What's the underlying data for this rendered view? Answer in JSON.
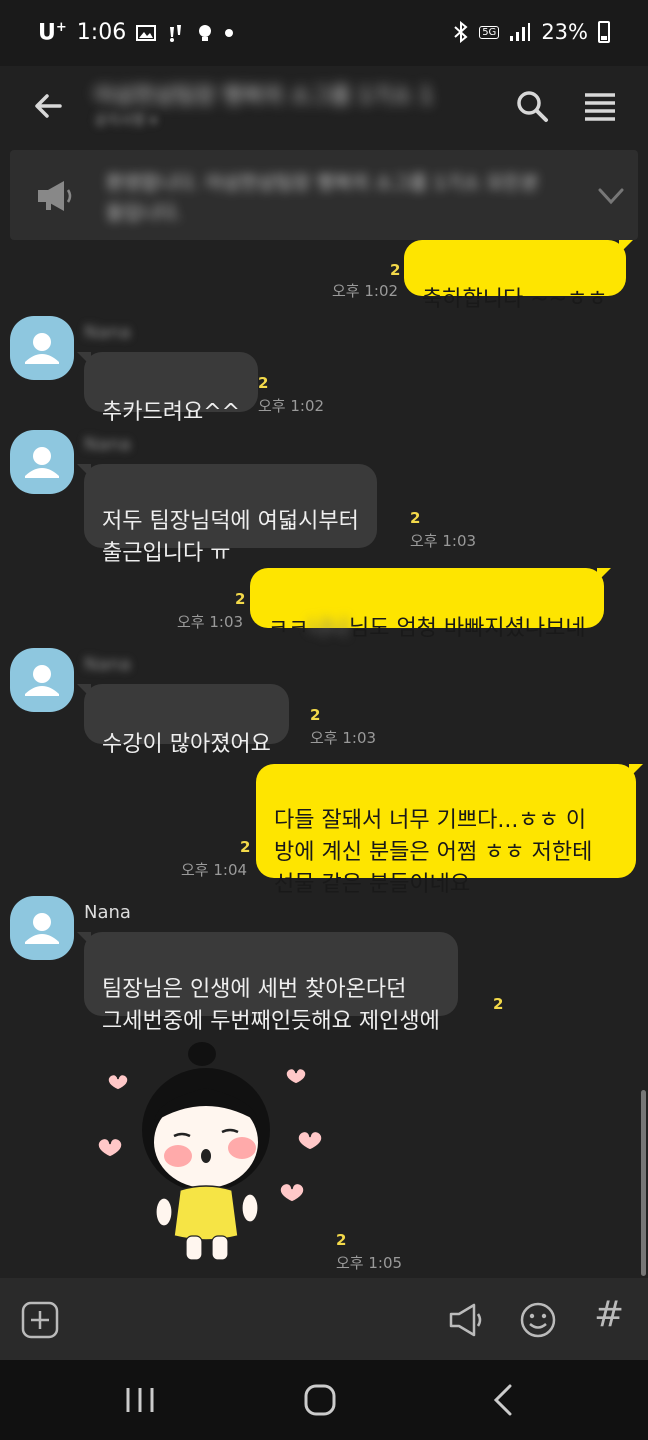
{
  "status_bar": {
    "carrier": "U",
    "carrier_sup": "+",
    "time": "1:06",
    "battery": "23%",
    "network_badge": "5G",
    "indicator_icons": [
      "image-icon",
      "notification-icon",
      "bulb-icon",
      "dot-icon"
    ],
    "right_icons": [
      "bluetooth-icon",
      "signal-icon",
      "battery-icon"
    ]
  },
  "header": {
    "title": "아삼한삼팀장 행복의 소그룹 1기소 1",
    "subtitle": "공지사항 ▾",
    "icons": [
      "back-arrow-icon",
      "search-icon",
      "menu-icon"
    ]
  },
  "notice": {
    "text": "환영합니다. 아삼한삼팀장 행복의 소그룹 1기소 모든분들입니다.",
    "icons": [
      "megaphone-icon",
      "chevron-down-icon"
    ]
  },
  "messages": [
    {
      "direction": "out",
      "text": "축하합니다 ~~ㅎㅎ",
      "unread": "2",
      "time": "오후 1:02"
    },
    {
      "direction": "in",
      "sender": "Nana",
      "text": "추카드려요^^",
      "unread": "2",
      "time": "오후 1:02"
    },
    {
      "direction": "in",
      "sender": "Nana",
      "text": "저두 팀장님덕에 여덟시부터\n출근입니다 ㅠ",
      "unread": "2",
      "time": "오후 1:03"
    },
    {
      "direction": "out",
      "text_before": "ㅋㅋ",
      "text_redacted": "나나",
      "text_after": "님도 엄청 바빠지셨나보네",
      "unread": "2",
      "time": "오후 1:03"
    },
    {
      "direction": "in",
      "sender": "Nana",
      "text": "수강이 많아졌어요",
      "unread": "2",
      "time": "오후 1:03"
    },
    {
      "direction": "out",
      "text": "다들 잘돼서 너무 기쁘다...ㅎㅎ 이\n방에 계신 분들은 어쩜 ㅎㅎ 저한테\n선물 같은 분들이네요",
      "unread": "2",
      "time": "오후 1:04"
    },
    {
      "direction": "in",
      "sender": "Nana",
      "text": "팀장님은 인생에 세번 찾아온다던\n그세번중에 두번째인듯해요 제인생에",
      "unread": "2",
      "time": ""
    },
    {
      "direction": "in",
      "type": "sticker",
      "sticker": "girl-blushing-hearts-sticker",
      "unread": "2",
      "time": "오후 1:05"
    }
  ],
  "input_bar": {
    "icons": [
      "plus-icon",
      "megaphone-icon",
      "emoji-icon",
      "hash-icon"
    ],
    "hash_label": "#"
  },
  "nav_bar": {
    "icons": [
      "recent-apps-icon",
      "home-icon",
      "back-icon"
    ]
  },
  "colors": {
    "background": "#212121",
    "outgoing_bubble": "#fee500",
    "incoming_bubble": "#3a3a3a",
    "unread": "#f3d94a",
    "avatar": "#8ec7df"
  }
}
